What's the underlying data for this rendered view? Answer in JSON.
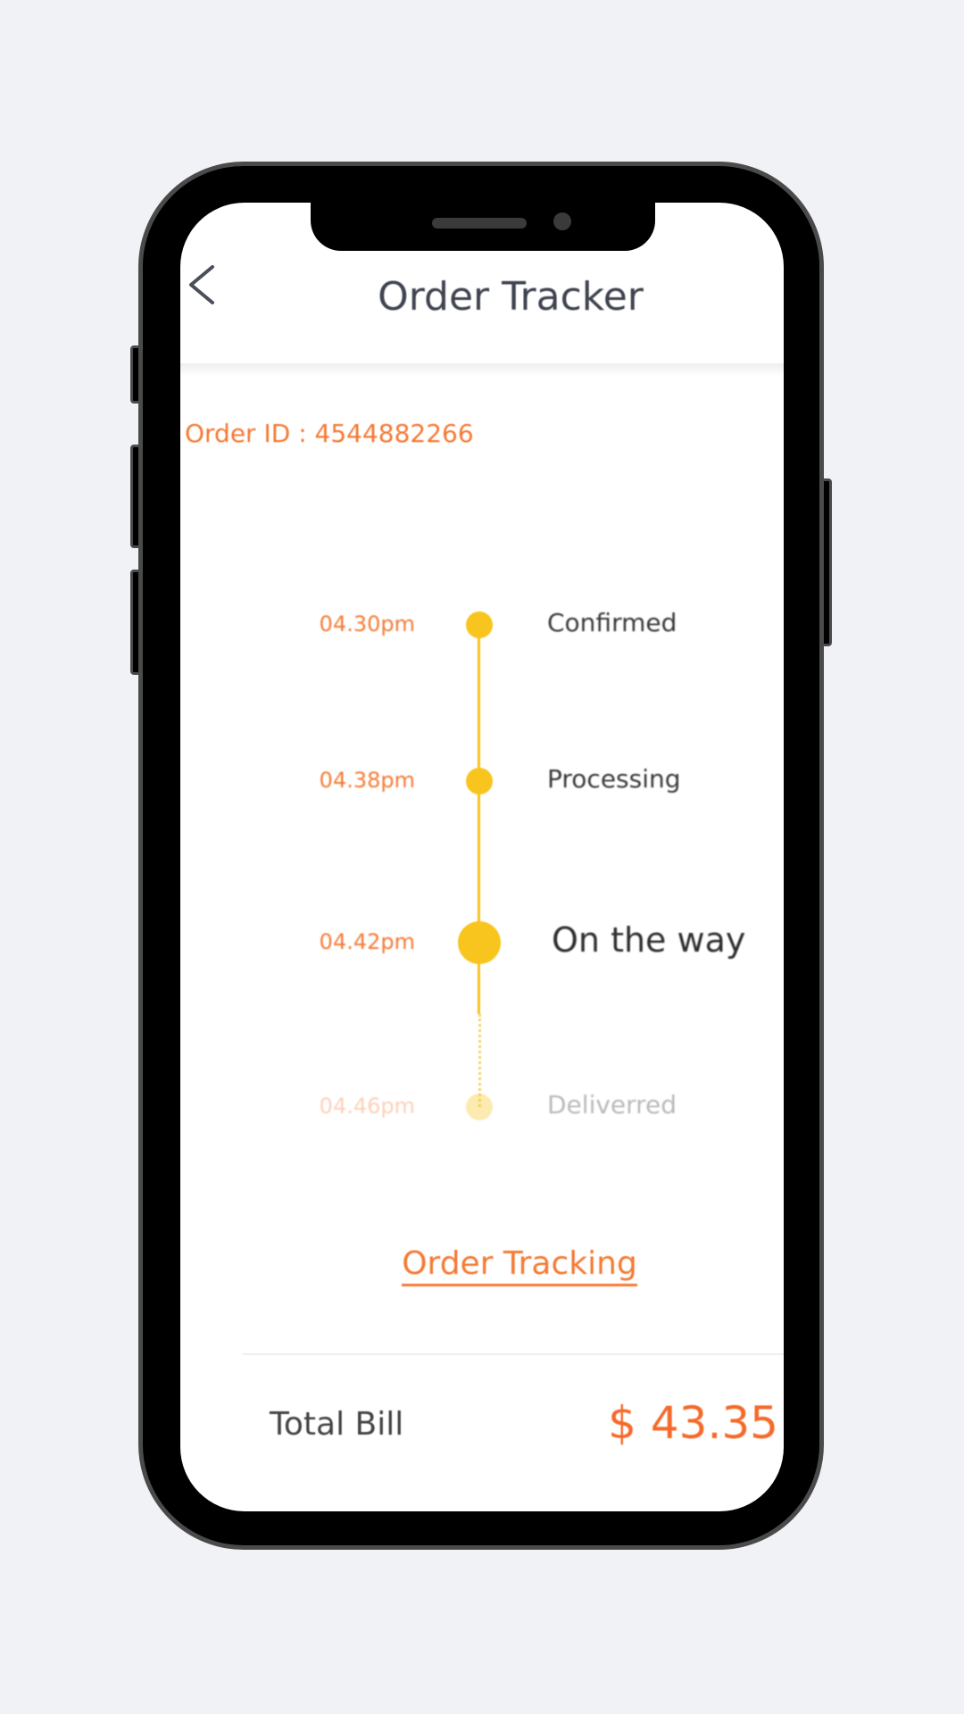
{
  "header": {
    "title": "Order Tracker",
    "back_icon": "chevron-left-icon"
  },
  "order": {
    "id_label": "Order ID : 4544882266"
  },
  "timeline": [
    {
      "time": "04.30pm",
      "status": "Confirmed",
      "state": "done"
    },
    {
      "time": "04.38pm",
      "status": "Processing",
      "state": "done"
    },
    {
      "time": "04.42pm",
      "status": "On the way",
      "state": "current"
    },
    {
      "time": "04.46pm",
      "status": "Deliverred",
      "state": "pending"
    }
  ],
  "tracking_link": "Order Tracking",
  "total": {
    "label": "Total Bill",
    "value": "$ 43.35"
  },
  "colors": {
    "accent": "#f47a34",
    "timeline": "#f8c51f",
    "background": "#f0f2f6"
  }
}
